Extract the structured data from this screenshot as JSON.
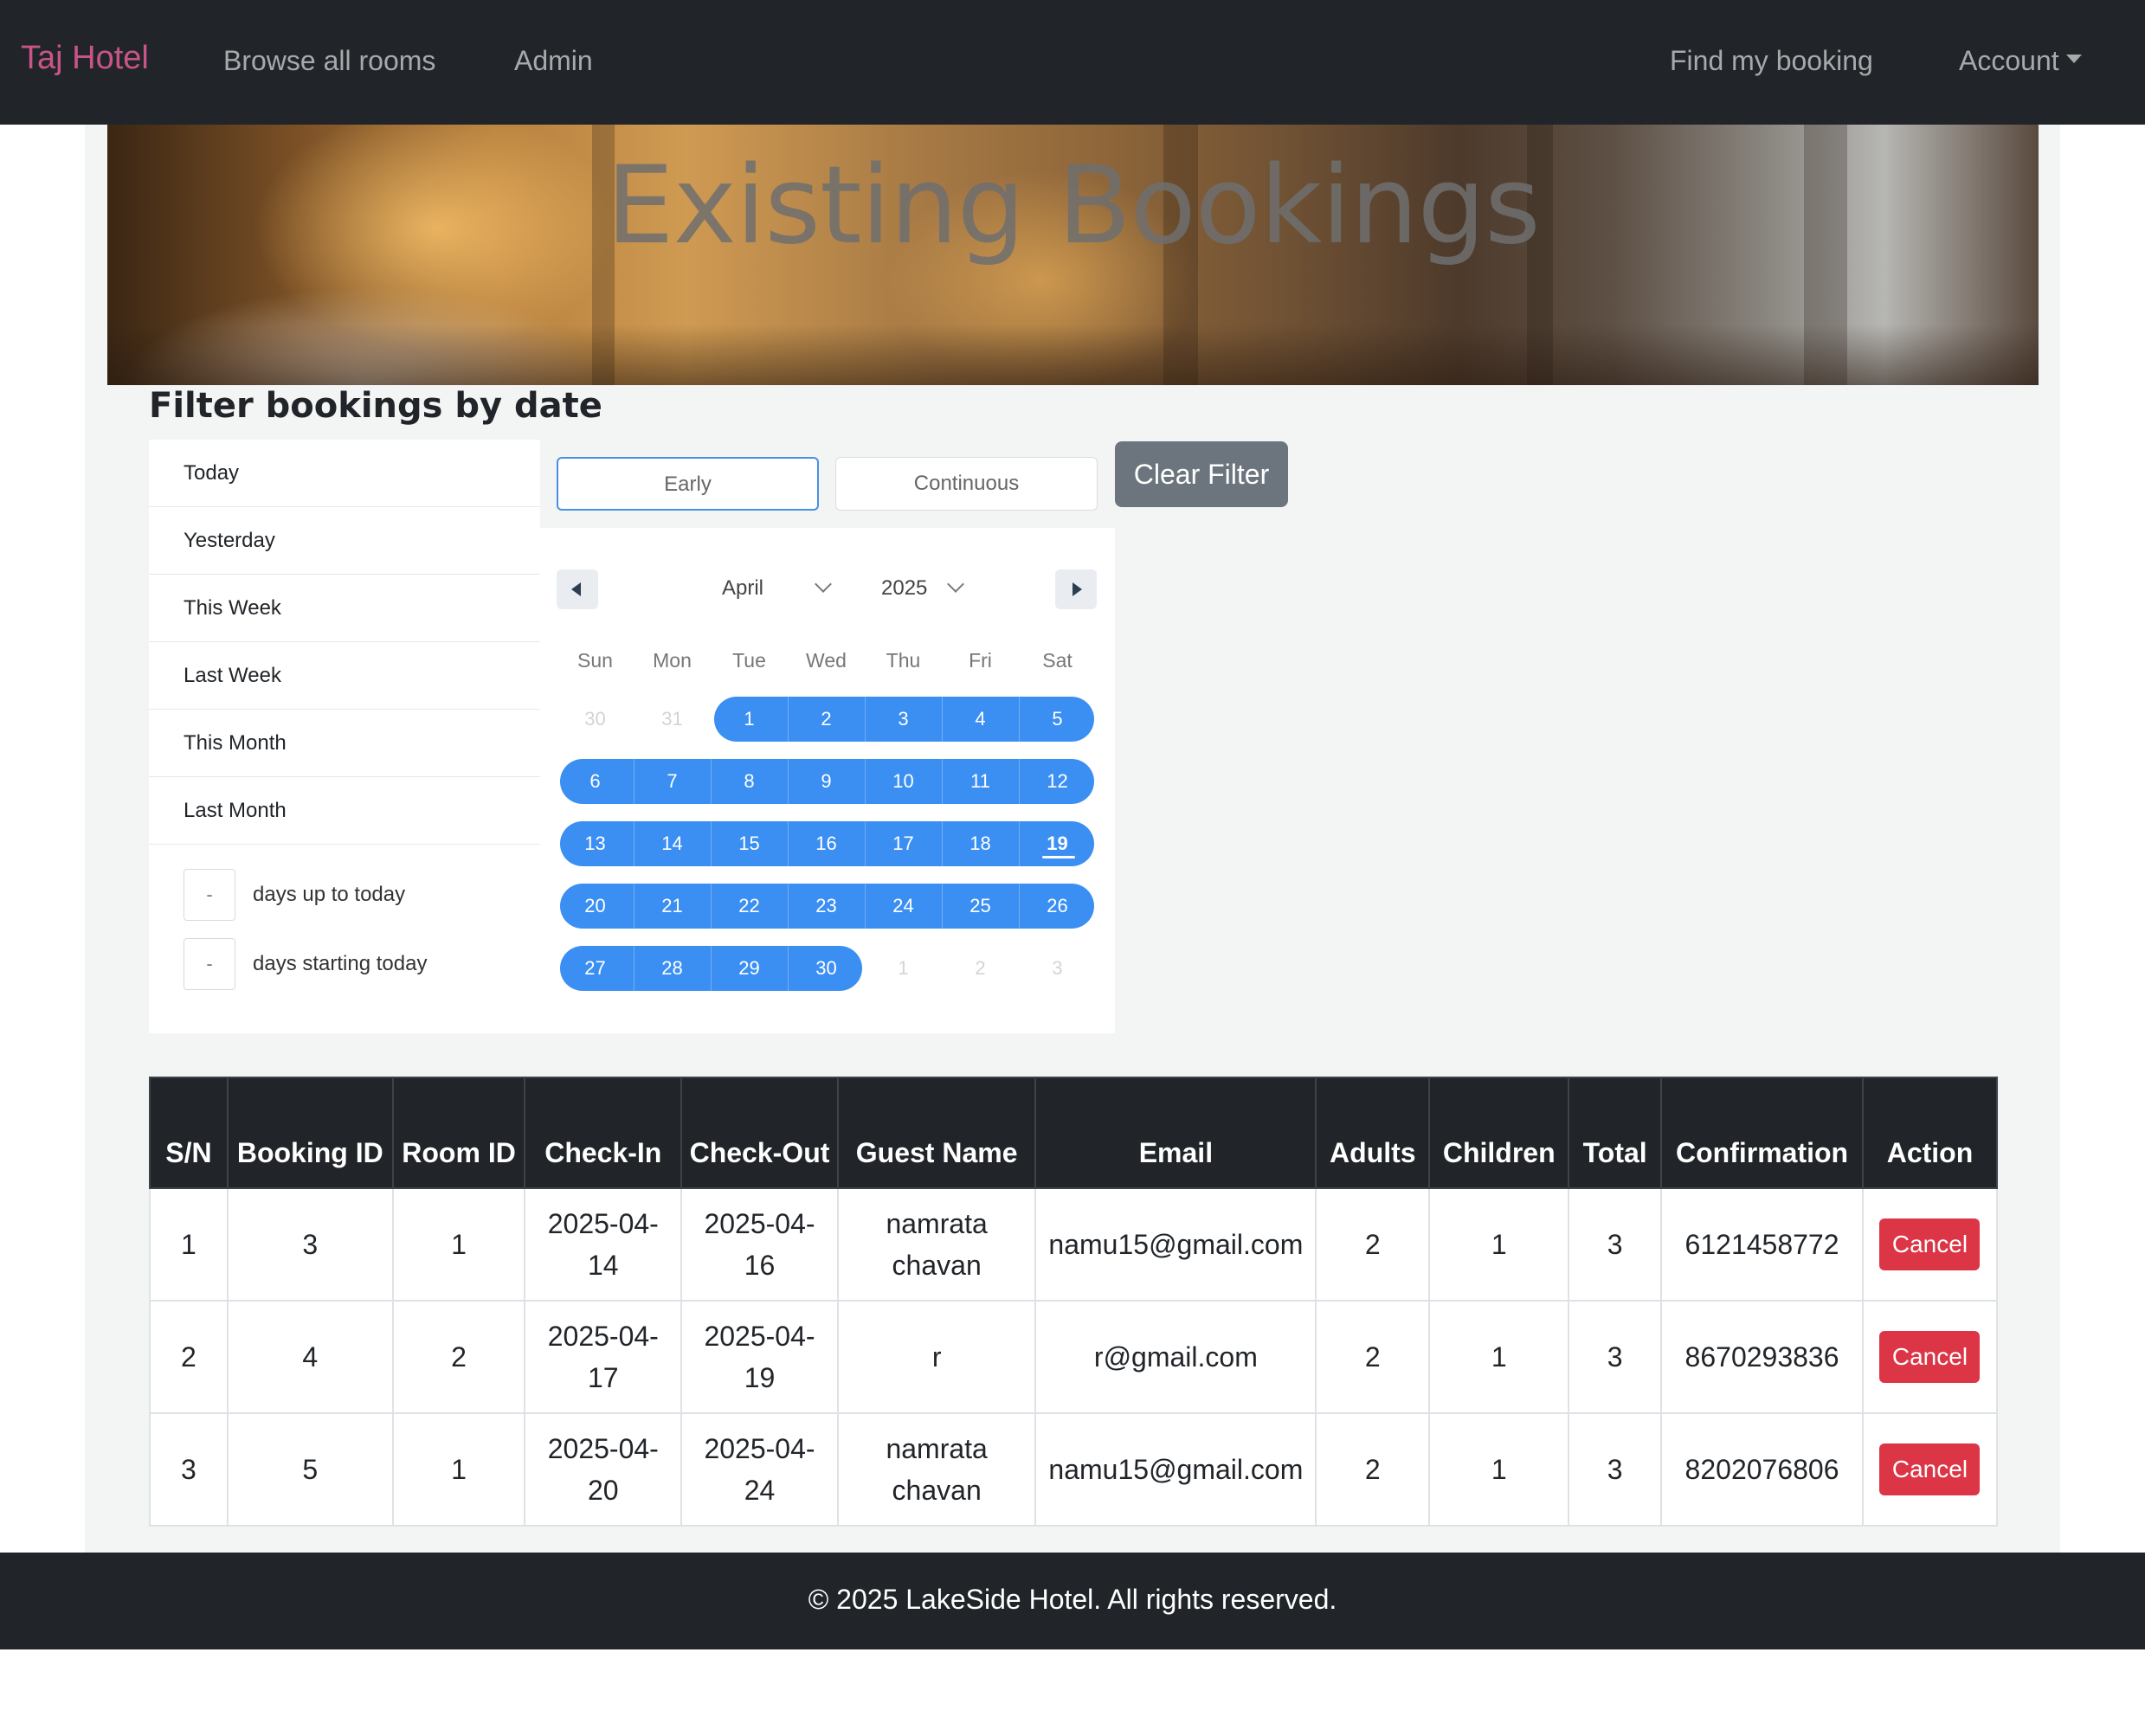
{
  "navbar": {
    "brand": "Taj Hotel",
    "browse": "Browse all rooms",
    "admin": "Admin",
    "find_booking": "Find my booking",
    "account": "Account"
  },
  "hero": {
    "title": "Existing Bookings"
  },
  "filter": {
    "heading": "Filter bookings by date",
    "presets": [
      "Today",
      "Yesterday",
      "This Week",
      "Last Week",
      "This Month",
      "Last Month"
    ],
    "days_up_value": "-",
    "days_up_label": "days up to today",
    "days_start_value": "-",
    "days_start_label": "days starting today",
    "toggle_early": "Early",
    "toggle_continuous": "Continuous",
    "active_toggle": "Early",
    "clear_button": "Clear Filter"
  },
  "calendar": {
    "month": "April",
    "year": "2025",
    "weekdays": [
      "Sun",
      "Mon",
      "Tue",
      "Wed",
      "Thu",
      "Fri",
      "Sat"
    ],
    "selected_color": "#3b8ff2",
    "today": "19",
    "weeks": [
      [
        "30",
        "31",
        "1",
        "2",
        "3",
        "4",
        "5"
      ],
      [
        "6",
        "7",
        "8",
        "9",
        "10",
        "11",
        "12"
      ],
      [
        "13",
        "14",
        "15",
        "16",
        "17",
        "18",
        "19"
      ],
      [
        "20",
        "21",
        "22",
        "23",
        "24",
        "25",
        "26"
      ],
      [
        "27",
        "28",
        "29",
        "30",
        "1",
        "2",
        "3"
      ]
    ]
  },
  "table": {
    "headers": [
      "S/N",
      "Booking ID",
      "Room ID",
      "Check-In",
      "Check-Out",
      "Guest Name",
      "Email",
      "Adults",
      "Children",
      "Total",
      "Confirmation",
      "Action"
    ],
    "rows": [
      [
        "1",
        "3",
        "1",
        "2025-04-14",
        "2025-04-16",
        "namrata chavan",
        "namu15@gmail.com",
        "2",
        "1",
        "3",
        "6121458772",
        "Cancel"
      ],
      [
        "2",
        "4",
        "2",
        "2025-04-17",
        "2025-04-19",
        "r",
        "r@gmail.com",
        "2",
        "1",
        "3",
        "8670293836",
        "Cancel"
      ],
      [
        "3",
        "5",
        "1",
        "2025-04-20",
        "2025-04-24",
        "namrata chavan",
        "namu15@gmail.com",
        "2",
        "1",
        "3",
        "8202076806",
        "Cancel"
      ]
    ]
  },
  "footer": {
    "text": "© 2025 LakeSide Hotel. All rights reserved."
  },
  "colors": {
    "navbar_bg": "#212529",
    "brand": "#c95488",
    "cancel_button": "#dc3545",
    "clear_button": "#6c757d",
    "range_blue": "#3b8ff2"
  }
}
